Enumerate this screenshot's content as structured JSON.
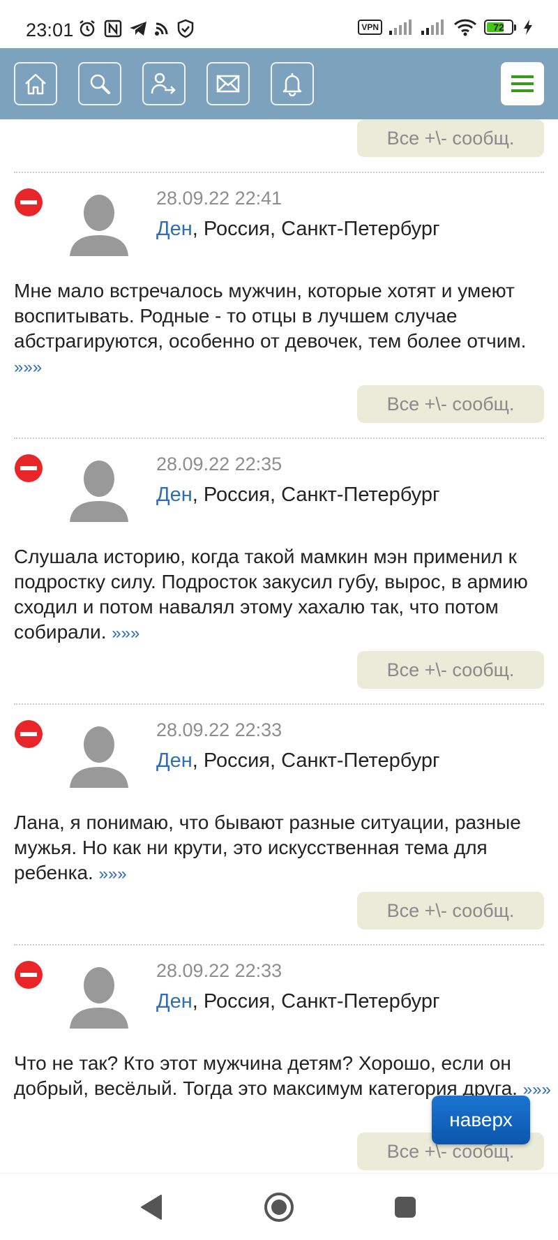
{
  "status_bar": {
    "time": "23:01",
    "vpn_label": "VPN",
    "battery_level": "72",
    "left_icons": [
      "alarm-icon",
      "nfc-icon",
      "telegram-icon",
      "cast-icon",
      "shield-icon"
    ],
    "right_icons": [
      "signal-icon",
      "signal-icon",
      "wifi-icon",
      "battery-icon",
      "charging-icon"
    ]
  },
  "topnav": {
    "background": "#7da2bd",
    "buttons": [
      "home-icon",
      "search-icon",
      "login-icon",
      "mail-icon",
      "bell-icon"
    ],
    "menu_icon": "hamburger-menu-icon"
  },
  "common": {
    "all_messages_label": "Все +\\- сообщ.",
    "more_label": "»»»"
  },
  "posts": [
    {
      "date": "28.09.22 22:41",
      "author": "Ден",
      "location": ", Россия, Санкт-Петербург",
      "text": "Мне мало встречалось мужчин, которые хотят и умеют воспитывать. Родные - то отцы в лучшем случае абстрагируются, особенно от девочек, тем более отчим."
    },
    {
      "date": "28.09.22 22:35",
      "author": "Ден",
      "location": ", Россия, Санкт-Петербург",
      "text": "Слушала историю, когда такой мамкин мэн применил к подростку силу. Подросток закусил губу, вырос, в армию сходил и потом навалял этому хахалю так, что потом собирали."
    },
    {
      "date": "28.09.22 22:33",
      "author": "Ден",
      "location": ", Россия, Санкт-Петербург",
      "text": "Лана, я понимаю, что бывают разные ситуации, разные мужья. Но как ни крути, это искусственная тема для ребенка."
    },
    {
      "date": "28.09.22 22:33",
      "author": "Ден",
      "location": ", Россия, Санкт-Петербург",
      "text": "Что не так? Кто этот мужчина детям? Хорошо, если он добрый, весёлый. Тогда это максимум категория друга."
    }
  ],
  "scroll_top_label": "наверх",
  "system_nav": [
    "back-icon",
    "home-circle-icon",
    "recents-icon"
  ]
}
